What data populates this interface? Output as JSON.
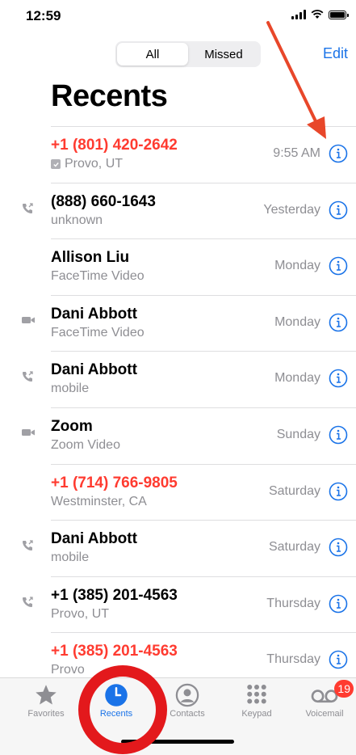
{
  "status": {
    "time": "12:59"
  },
  "segment": {
    "all": "All",
    "missed": "Missed",
    "selected": "All"
  },
  "header": {
    "edit": "Edit",
    "title": "Recents"
  },
  "calls": [
    {
      "name": "+1 (801) 420-2642",
      "sub": "Provo, UT",
      "when": "9:55 AM",
      "missed": true,
      "type": "none",
      "verified": true
    },
    {
      "name": "(888) 660-1643",
      "sub": "unknown",
      "when": "Yesterday",
      "missed": false,
      "type": "phone"
    },
    {
      "name": "Allison Liu",
      "sub": "FaceTime Video",
      "when": "Monday",
      "missed": false,
      "type": "none"
    },
    {
      "name": "Dani Abbott",
      "sub": "FaceTime Video",
      "when": "Monday",
      "missed": false,
      "type": "video"
    },
    {
      "name": "Dani Abbott",
      "sub": "mobile",
      "when": "Monday",
      "missed": false,
      "type": "phone"
    },
    {
      "name": "Zoom",
      "sub": "Zoom Video",
      "when": "Sunday",
      "missed": false,
      "type": "video"
    },
    {
      "name": "+1 (714) 766-9805",
      "sub": "Westminster, CA",
      "when": "Saturday",
      "missed": true,
      "type": "none"
    },
    {
      "name": "Dani Abbott",
      "sub": "mobile",
      "when": "Saturday",
      "missed": false,
      "type": "phone"
    },
    {
      "name": "+1 (385) 201-4563",
      "sub": "Provo, UT",
      "when": "Thursday",
      "missed": false,
      "type": "phone"
    },
    {
      "name": "+1 (385) 201-4563",
      "sub": "Provo",
      "when": "Thursday",
      "missed": true,
      "type": "none"
    }
  ],
  "tabs": [
    {
      "label": "Favorites",
      "icon": "star-icon"
    },
    {
      "label": "Recents",
      "icon": "clock-icon",
      "active": true
    },
    {
      "label": "Contacts",
      "icon": "person-icon"
    },
    {
      "label": "Keypad",
      "icon": "keypad-icon"
    },
    {
      "label": "Voicemail",
      "icon": "voicemail-icon",
      "badge": "19"
    }
  ],
  "colors": {
    "accent": "#1a73e8",
    "missed": "#ff3b30",
    "annotation": "#e3191c"
  }
}
